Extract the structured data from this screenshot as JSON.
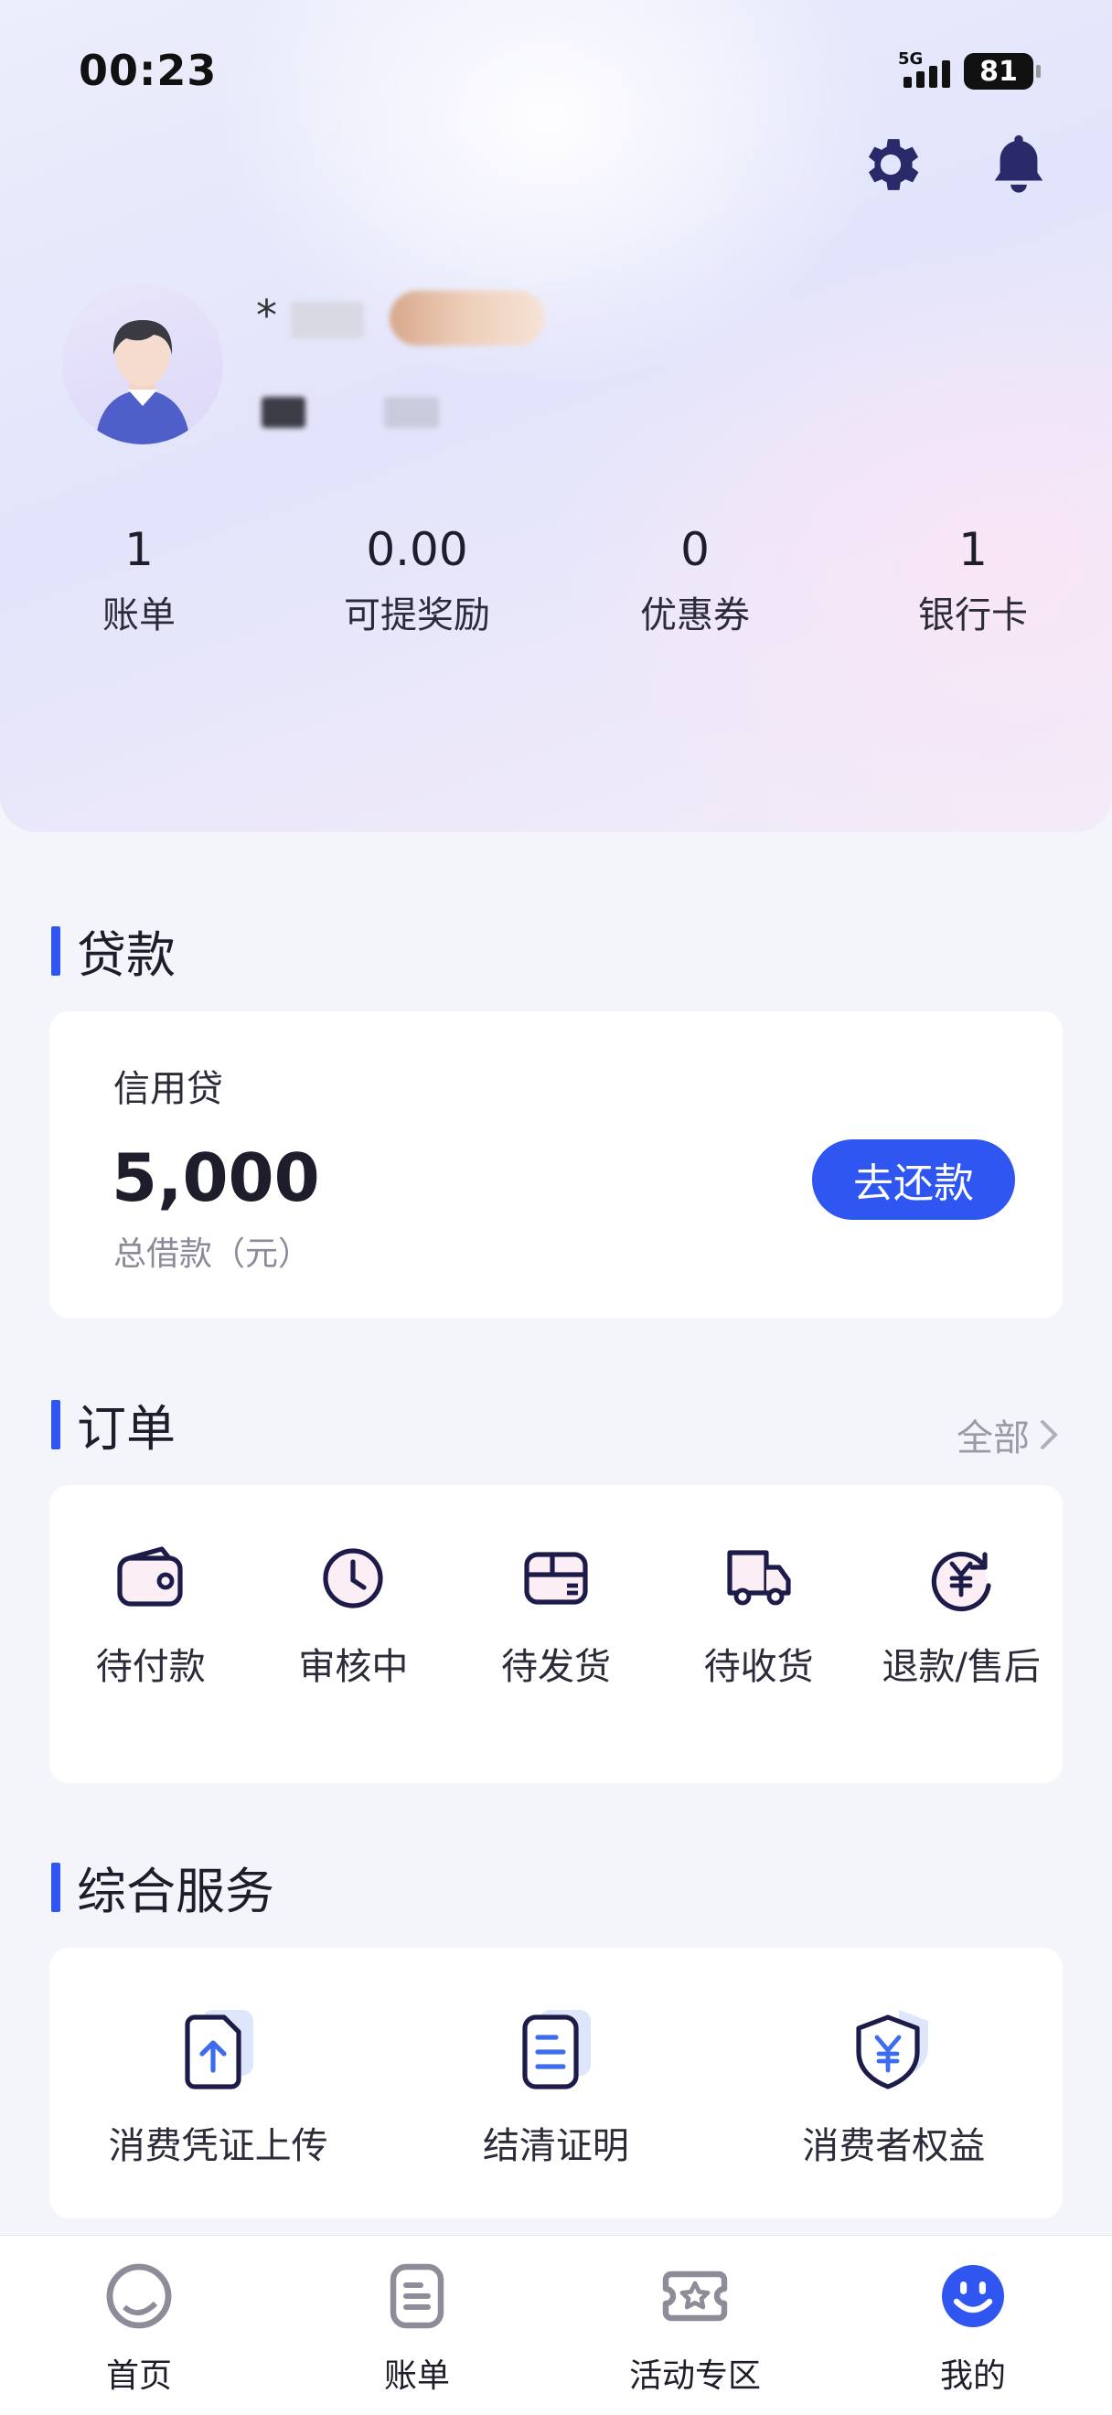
{
  "status_bar": {
    "time": "00:23",
    "network": "5G",
    "battery": "81"
  },
  "profile": {
    "name_partial": "*"
  },
  "stats": [
    {
      "value": "1",
      "label": "账单"
    },
    {
      "value": "0.00",
      "label": "可提奖励"
    },
    {
      "value": "0",
      "label": "优惠券"
    },
    {
      "value": "1",
      "label": "银行卡"
    }
  ],
  "loan": {
    "section_title": "贷款",
    "type": "信用贷",
    "amount": "5,000",
    "amount_label": "总借款（元）",
    "repay_button": "去还款"
  },
  "orders": {
    "section_title": "订单",
    "all_label": "全部",
    "items": [
      {
        "label": "待付款",
        "icon": "wallet-icon"
      },
      {
        "label": "审核中",
        "icon": "clock-icon"
      },
      {
        "label": "待发货",
        "icon": "package-icon"
      },
      {
        "label": "待收货",
        "icon": "truck-icon"
      },
      {
        "label": "退款/售后",
        "icon": "refund-yen-icon"
      }
    ]
  },
  "services": {
    "section_title": "综合服务",
    "items": [
      {
        "label": "消费凭证上传",
        "icon": "upload-document-icon"
      },
      {
        "label": "结清证明",
        "icon": "certificate-document-icon"
      },
      {
        "label": "消费者权益",
        "icon": "shield-yen-icon"
      }
    ]
  },
  "tabbar": [
    {
      "label": "首页",
      "icon": "home-circle-icon"
    },
    {
      "label": "账单",
      "icon": "bill-icon"
    },
    {
      "label": "活动专区",
      "icon": "ticket-star-icon"
    },
    {
      "label": "我的",
      "icon": "smiley-profile-icon",
      "active": true
    }
  ],
  "colors": {
    "accent": "#2f56f0",
    "text": "#1d1d2b",
    "muted": "#8a8a99",
    "icon_stroke": "#1c1b4a"
  }
}
